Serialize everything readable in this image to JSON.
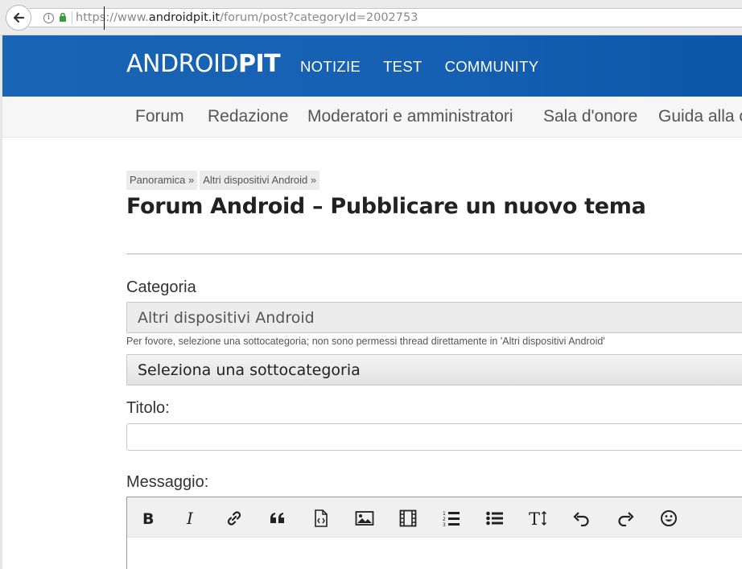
{
  "browser": {
    "url_scheme": "https://www.",
    "url_host": "androidpit.it",
    "url_path": "/forum/post?categoryId=2002753"
  },
  "header": {
    "logo_thin": "ANDROID",
    "logo_bold": "PIT",
    "nav": [
      "NOTIZIE",
      "TEST",
      "COMMUNITY"
    ]
  },
  "subnav": [
    "Forum",
    "Redazione",
    "Moderatori e amministratori",
    "Sala d'onore",
    "Guida alla c"
  ],
  "breadcrumb": [
    "Panoramica »",
    "Altri dispositivi Android »"
  ],
  "page_title": "Forum Android – Pubblicare un nuovo tema",
  "form": {
    "category_label": "Categoria",
    "category_value": "Altri dispositivi Android",
    "hint": "Per fovore, selezione una sottocategoria; non sono permessi thread direttamente in 'Altri dispositivi Android'",
    "subcategory_value": "Seleziona una sottocategoria",
    "title_label": "Titolo:",
    "title_value": "",
    "message_label": "Messaggio:"
  },
  "toolbar_icons": [
    "bold-icon",
    "italic-icon",
    "link-icon",
    "quote-icon",
    "code-icon",
    "image-icon",
    "video-icon",
    "ordered-list-icon",
    "unordered-list-icon",
    "text-size-icon",
    "undo-icon",
    "redo-icon",
    "emoji-icon"
  ],
  "colors": {
    "header_blue": "#1560b3",
    "subnav_bg": "#f6f6f6"
  }
}
